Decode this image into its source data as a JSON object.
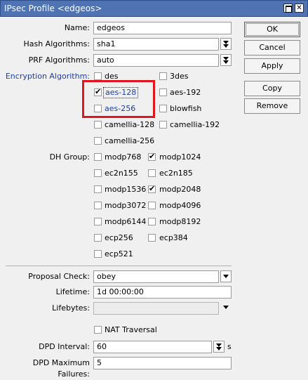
{
  "window": {
    "title": "IPsec Profile <edgeos>"
  },
  "fields": {
    "name": {
      "label": "Name:",
      "value": "edgeos"
    },
    "hash": {
      "label": "Hash Algorithms:",
      "value": "sha1"
    },
    "prf": {
      "label": "PRF Algorithms:",
      "value": "auto"
    },
    "encryption_label": "Encryption Algorithm:",
    "dh_label": "DH Group:",
    "proposal": {
      "label": "Proposal Check:",
      "value": "obey"
    },
    "lifetime": {
      "label": "Lifetime:",
      "value": "1d 00:00:00"
    },
    "lifebytes": {
      "label": "Lifebytes:",
      "value": ""
    },
    "nat": {
      "label": "NAT Traversal",
      "checked": false
    },
    "dpd_interval": {
      "label": "DPD Interval:",
      "value": "60",
      "unit": "s"
    },
    "dpd_max": {
      "label": "DPD Maximum Failures:",
      "value": "5"
    }
  },
  "encryption": [
    {
      "label": "des",
      "checked": false
    },
    {
      "label": "3des",
      "checked": false
    },
    {
      "label": "aes-128",
      "checked": true
    },
    {
      "label": "aes-192",
      "checked": false
    },
    {
      "label": "aes-256",
      "checked": false
    },
    {
      "label": "blowfish",
      "checked": false
    },
    {
      "label": "camellia-128",
      "checked": false
    },
    {
      "label": "camellia-192",
      "checked": false
    },
    {
      "label": "camellia-256",
      "checked": false
    }
  ],
  "dh_groups": [
    {
      "label": "modp768",
      "checked": false
    },
    {
      "label": "modp1024",
      "checked": true
    },
    {
      "label": "ec2n155",
      "checked": false
    },
    {
      "label": "ec2n185",
      "checked": false
    },
    {
      "label": "modp1536",
      "checked": false
    },
    {
      "label": "modp2048",
      "checked": true
    },
    {
      "label": "modp3072",
      "checked": false
    },
    {
      "label": "modp4096",
      "checked": false
    },
    {
      "label": "modp6144",
      "checked": false
    },
    {
      "label": "modp8192",
      "checked": false
    },
    {
      "label": "ecp256",
      "checked": false
    },
    {
      "label": "ecp384",
      "checked": false
    },
    {
      "label": "ecp521",
      "checked": false
    }
  ],
  "buttons": {
    "ok": "OK",
    "cancel": "Cancel",
    "apply": "Apply",
    "copy": "Copy",
    "remove": "Remove"
  },
  "colors": {
    "titlebar": "#4e72b2",
    "highlight": "#e0161e",
    "link_blue": "#1c3ea5"
  }
}
